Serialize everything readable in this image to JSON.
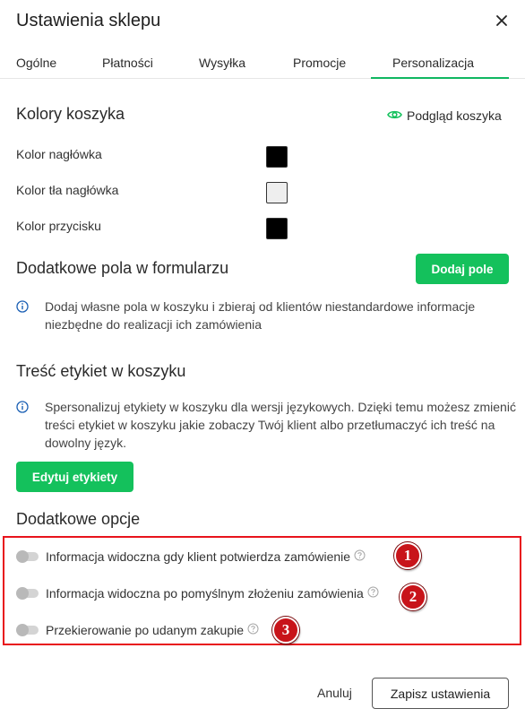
{
  "header": {
    "title": "Ustawienia sklepu"
  },
  "tabs": [
    {
      "label": "Ogólne"
    },
    {
      "label": "Płatności"
    },
    {
      "label": "Wysyłka"
    },
    {
      "label": "Promocje"
    },
    {
      "label": "Personalizacja",
      "active": true
    }
  ],
  "cart_colors": {
    "title": "Kolory koszyka",
    "preview_label": "Podgląd koszyka",
    "rows": [
      {
        "label": "Kolor nagłówka",
        "color": "#000000"
      },
      {
        "label": "Kolor tła nagłówka",
        "color": "#eeeeee"
      },
      {
        "label": "Kolor przycisku",
        "color": "#000000"
      }
    ]
  },
  "extra_fields": {
    "title": "Dodatkowe pola w formularzu",
    "add_button": "Dodaj pole",
    "info": "Dodaj własne pola w koszyku i zbieraj od klientów niestandardowe informacje niezbędne do realizacji ich zamówienia"
  },
  "labels_content": {
    "title": "Treść etykiet w koszyku",
    "info": "Spersonalizuj etykiety w koszyku dla wersji językowych. Dzięki temu możesz zmienić treści etykiet w koszyku jakie zobaczy Twój klient albo przetłumaczyć ich treść na dowolny język.",
    "edit_button": "Edytuj etykiety"
  },
  "extra_options": {
    "title": "Dodatkowe opcje",
    "items": [
      {
        "label": "Informacja widoczna gdy klient potwierdza zamówienie",
        "enabled": false,
        "badge": "1"
      },
      {
        "label": "Informacja widoczna po pomyślnym złożeniu zamówienia",
        "enabled": false,
        "badge": "2"
      },
      {
        "label": "Przekierowanie po udanym zakupie",
        "enabled": false,
        "badge": "3"
      }
    ]
  },
  "footer": {
    "cancel_label": "Anuluj",
    "save_label": "Zapisz ustawienia"
  },
  "colors": {
    "accent": "#14c15c",
    "highlight": "#e8131c",
    "badge": "#c8141a"
  }
}
